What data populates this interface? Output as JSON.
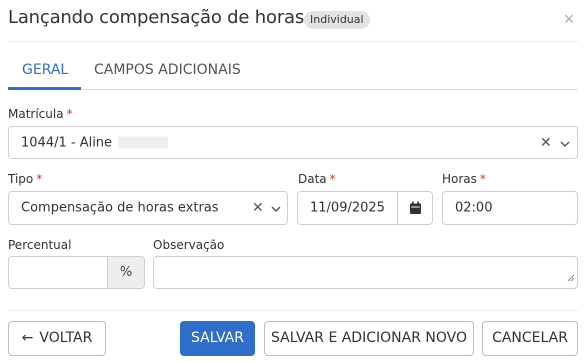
{
  "dialog": {
    "title": "Lançando compensação de horas",
    "badge": "Individual",
    "close_icon": "×"
  },
  "tabs": [
    {
      "label": "GERAL",
      "active": true
    },
    {
      "label": "CAMPOS ADICIONAIS",
      "active": false
    }
  ],
  "form": {
    "matricula": {
      "label": "Matrícula",
      "required_mark": "*",
      "value": "1044/1 - Aline"
    },
    "tipo": {
      "label": "Tipo",
      "required_mark": "*",
      "value": "Compensação de horas extras"
    },
    "data": {
      "label": "Data",
      "required_mark": "*",
      "value": "11/09/2025"
    },
    "horas": {
      "label": "Horas",
      "required_mark": "*",
      "value": "02:00"
    },
    "percentual": {
      "label": "Percentual",
      "value": "",
      "suffix": "%"
    },
    "observacao": {
      "label": "Observação",
      "value": ""
    }
  },
  "footer": {
    "back_label": "VOLTAR",
    "back_icon": "←",
    "save_label": "SALVAR",
    "save_add_label": "SALVAR E ADICIONAR NOVO",
    "cancel_label": "CANCELAR"
  },
  "colors": {
    "accent": "#2f6fc9",
    "required": "#d9342b",
    "badge_bg": "#e3e3e3"
  }
}
